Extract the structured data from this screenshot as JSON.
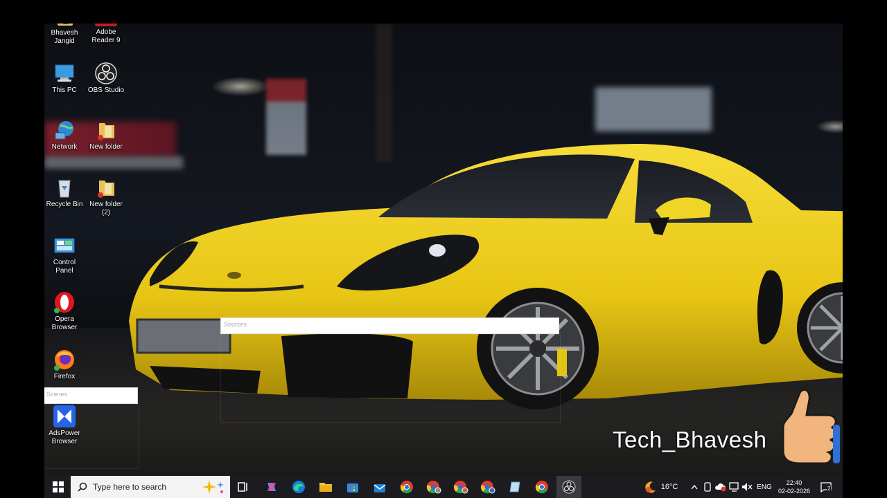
{
  "desktop": {
    "icons": [
      {
        "id": "bhavesh-jangid",
        "label": "Bhavesh\nJangid",
        "icon": "user-folder-icon"
      },
      {
        "id": "adobe-reader",
        "label": "Adobe\nReader 9",
        "icon": "adobe-reader-icon"
      },
      {
        "id": "this-pc",
        "label": "This PC",
        "icon": "computer-icon"
      },
      {
        "id": "obs-studio",
        "label": "OBS Studio",
        "icon": "obs-icon"
      },
      {
        "id": "network",
        "label": "Network",
        "icon": "network-globe-icon"
      },
      {
        "id": "new-folder",
        "label": "New folder",
        "icon": "folder-icon"
      },
      {
        "id": "recycle-bin",
        "label": "Recycle Bin",
        "icon": "recycle-bin-icon"
      },
      {
        "id": "new-folder-2",
        "label": "New folder\n(2)",
        "icon": "folder-icon"
      },
      {
        "id": "control-panel",
        "label": "Control\nPanel",
        "icon": "control-panel-icon"
      },
      {
        "id": "opera-browser",
        "label": "Opera\nBrowser",
        "icon": "opera-icon"
      },
      {
        "id": "firefox",
        "label": "Firefox",
        "icon": "firefox-icon"
      },
      {
        "id": "adspower-browser",
        "label": "AdsPower\nBrowser",
        "icon": "adspower-icon"
      }
    ]
  },
  "obs_overlay": {
    "sources_label": "Sources",
    "scenes_label": "Scenes"
  },
  "watermark": "Tech_Bhavesh",
  "taskbar": {
    "search_placeholder": "Type here to search",
    "apps": [
      "copilot-icon",
      "edge-icon",
      "file-explorer-icon",
      "store-icon",
      "mail-icon",
      "chrome-icon",
      "chrome-profile-icon",
      "chrome-profile-icon",
      "chrome-profile-icon",
      "notepad-icon",
      "chrome-icon",
      "obs-icon"
    ],
    "weather_temp": "16°C",
    "language": "ENG",
    "time": "22:40",
    "date": "02-02-2026",
    "notification_count": "2"
  },
  "colors": {
    "accent_yellow": "#f2d21b",
    "taskbar": "#1c1c20"
  }
}
